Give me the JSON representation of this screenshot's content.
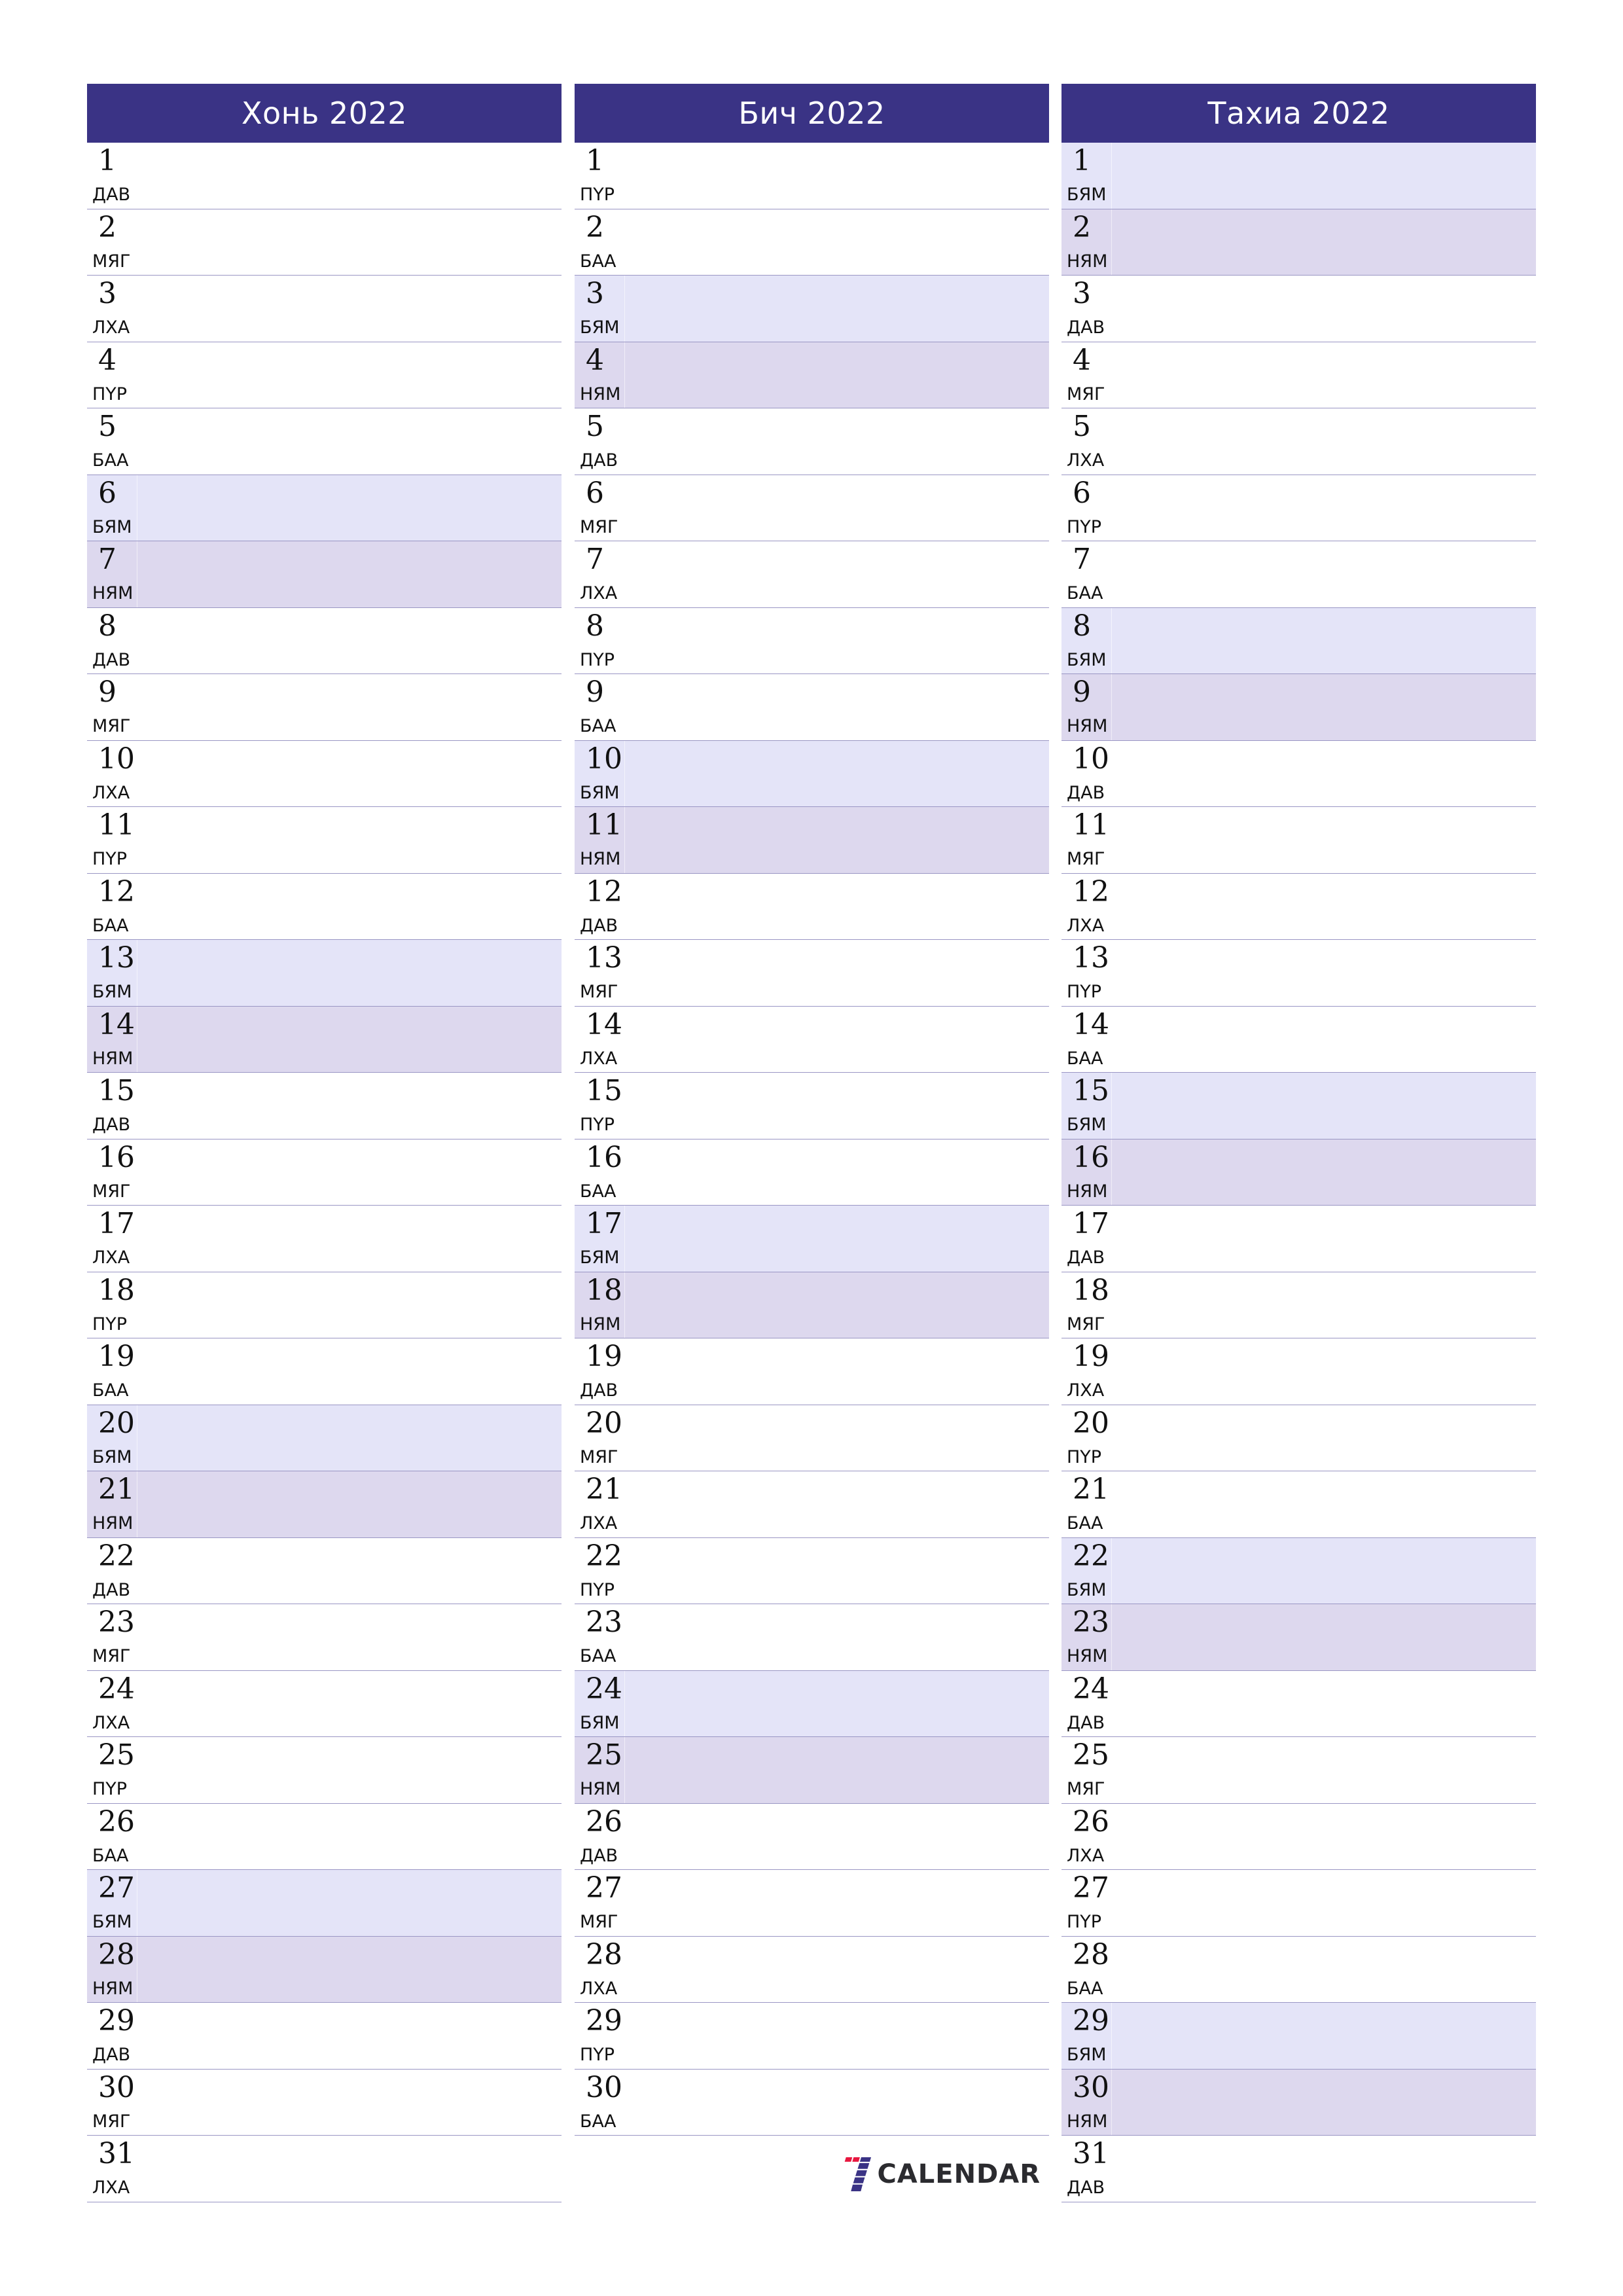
{
  "colors": {
    "header_bg": "#3A3385",
    "header_text": "#FFFFFF",
    "saturday_bg": "#E4E4F8",
    "sunday_bg": "#DDD8EE",
    "divider": "#9A96C4",
    "logo_red": "#E8173F",
    "logo_blue": "#3A3385"
  },
  "months": [
    {
      "title": "Хонь 2022",
      "days": [
        {
          "n": "1",
          "wd": "ДАВ"
        },
        {
          "n": "2",
          "wd": "МЯГ"
        },
        {
          "n": "3",
          "wd": "ЛХА"
        },
        {
          "n": "4",
          "wd": "ПҮР"
        },
        {
          "n": "5",
          "wd": "БАА"
        },
        {
          "n": "6",
          "wd": "БЯМ"
        },
        {
          "n": "7",
          "wd": "НЯМ"
        },
        {
          "n": "8",
          "wd": "ДАВ"
        },
        {
          "n": "9",
          "wd": "МЯГ"
        },
        {
          "n": "10",
          "wd": "ЛХА"
        },
        {
          "n": "11",
          "wd": "ПҮР"
        },
        {
          "n": "12",
          "wd": "БАА"
        },
        {
          "n": "13",
          "wd": "БЯМ"
        },
        {
          "n": "14",
          "wd": "НЯМ"
        },
        {
          "n": "15",
          "wd": "ДАВ"
        },
        {
          "n": "16",
          "wd": "МЯГ"
        },
        {
          "n": "17",
          "wd": "ЛХА"
        },
        {
          "n": "18",
          "wd": "ПҮР"
        },
        {
          "n": "19",
          "wd": "БАА"
        },
        {
          "n": "20",
          "wd": "БЯМ"
        },
        {
          "n": "21",
          "wd": "НЯМ"
        },
        {
          "n": "22",
          "wd": "ДАВ"
        },
        {
          "n": "23",
          "wd": "МЯГ"
        },
        {
          "n": "24",
          "wd": "ЛХА"
        },
        {
          "n": "25",
          "wd": "ПҮР"
        },
        {
          "n": "26",
          "wd": "БАА"
        },
        {
          "n": "27",
          "wd": "БЯМ"
        },
        {
          "n": "28",
          "wd": "НЯМ"
        },
        {
          "n": "29",
          "wd": "ДАВ"
        },
        {
          "n": "30",
          "wd": "МЯГ"
        },
        {
          "n": "31",
          "wd": "ЛХА"
        }
      ]
    },
    {
      "title": "Бич 2022",
      "days": [
        {
          "n": "1",
          "wd": "ПҮР"
        },
        {
          "n": "2",
          "wd": "БАА"
        },
        {
          "n": "3",
          "wd": "БЯМ"
        },
        {
          "n": "4",
          "wd": "НЯМ"
        },
        {
          "n": "5",
          "wd": "ДАВ"
        },
        {
          "n": "6",
          "wd": "МЯГ"
        },
        {
          "n": "7",
          "wd": "ЛХА"
        },
        {
          "n": "8",
          "wd": "ПҮР"
        },
        {
          "n": "9",
          "wd": "БАА"
        },
        {
          "n": "10",
          "wd": "БЯМ"
        },
        {
          "n": "11",
          "wd": "НЯМ"
        },
        {
          "n": "12",
          "wd": "ДАВ"
        },
        {
          "n": "13",
          "wd": "МЯГ"
        },
        {
          "n": "14",
          "wd": "ЛХА"
        },
        {
          "n": "15",
          "wd": "ПҮР"
        },
        {
          "n": "16",
          "wd": "БАА"
        },
        {
          "n": "17",
          "wd": "БЯМ"
        },
        {
          "n": "18",
          "wd": "НЯМ"
        },
        {
          "n": "19",
          "wd": "ДАВ"
        },
        {
          "n": "20",
          "wd": "МЯГ"
        },
        {
          "n": "21",
          "wd": "ЛХА"
        },
        {
          "n": "22",
          "wd": "ПҮР"
        },
        {
          "n": "23",
          "wd": "БАА"
        },
        {
          "n": "24",
          "wd": "БЯМ"
        },
        {
          "n": "25",
          "wd": "НЯМ"
        },
        {
          "n": "26",
          "wd": "ДАВ"
        },
        {
          "n": "27",
          "wd": "МЯГ"
        },
        {
          "n": "28",
          "wd": "ЛХА"
        },
        {
          "n": "29",
          "wd": "ПҮР"
        },
        {
          "n": "30",
          "wd": "БАА"
        }
      ]
    },
    {
      "title": "Тахиа 2022",
      "days": [
        {
          "n": "1",
          "wd": "БЯМ"
        },
        {
          "n": "2",
          "wd": "НЯМ"
        },
        {
          "n": "3",
          "wd": "ДАВ"
        },
        {
          "n": "4",
          "wd": "МЯГ"
        },
        {
          "n": "5",
          "wd": "ЛХА"
        },
        {
          "n": "6",
          "wd": "ПҮР"
        },
        {
          "n": "7",
          "wd": "БАА"
        },
        {
          "n": "8",
          "wd": "БЯМ"
        },
        {
          "n": "9",
          "wd": "НЯМ"
        },
        {
          "n": "10",
          "wd": "ДАВ"
        },
        {
          "n": "11",
          "wd": "МЯГ"
        },
        {
          "n": "12",
          "wd": "ЛХА"
        },
        {
          "n": "13",
          "wd": "ПҮР"
        },
        {
          "n": "14",
          "wd": "БАА"
        },
        {
          "n": "15",
          "wd": "БЯМ"
        },
        {
          "n": "16",
          "wd": "НЯМ"
        },
        {
          "n": "17",
          "wd": "ДАВ"
        },
        {
          "n": "18",
          "wd": "МЯГ"
        },
        {
          "n": "19",
          "wd": "ЛХА"
        },
        {
          "n": "20",
          "wd": "ПҮР"
        },
        {
          "n": "21",
          "wd": "БАА"
        },
        {
          "n": "22",
          "wd": "БЯМ"
        },
        {
          "n": "23",
          "wd": "НЯМ"
        },
        {
          "n": "24",
          "wd": "ДАВ"
        },
        {
          "n": "25",
          "wd": "МЯГ"
        },
        {
          "n": "26",
          "wd": "ЛХА"
        },
        {
          "n": "27",
          "wd": "ПҮР"
        },
        {
          "n": "28",
          "wd": "БАА"
        },
        {
          "n": "29",
          "wd": "БЯМ"
        },
        {
          "n": "30",
          "wd": "НЯМ"
        },
        {
          "n": "31",
          "wd": "ДАВ"
        }
      ]
    }
  ],
  "weekend": {
    "saturday": "БЯМ",
    "sunday": "НЯМ"
  },
  "logo": {
    "text": "CALENDAR",
    "icon": "seven-logo-icon"
  }
}
